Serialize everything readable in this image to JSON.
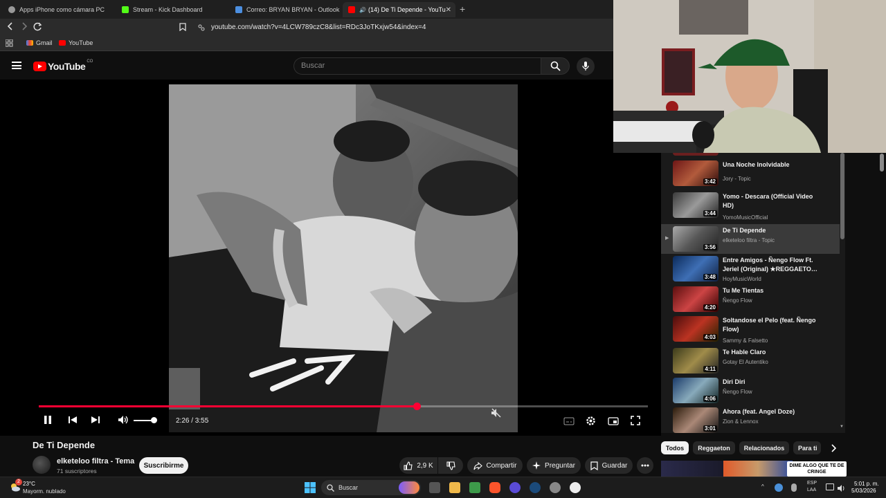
{
  "browser": {
    "tabs": [
      {
        "label": "Apps iPhone como cámara PC",
        "active": false
      },
      {
        "label": "Stream - Kick Dashboard",
        "active": false
      },
      {
        "label": "Correo: BRYAN BRYAN - Outlook",
        "active": false
      },
      {
        "label": "(14) De Ti Depende - YouTube",
        "active": true
      }
    ],
    "url": "youtube.com/watch?v=4LCW789czC8&list=RDc3JoTKxjw54&index=4",
    "bookmarks": [
      "Gmail",
      "YouTube"
    ]
  },
  "youtube": {
    "logo_text": "YouTube",
    "country_code": "CO",
    "search_placeholder": "Buscar"
  },
  "player": {
    "current_time": "2:26",
    "duration": "3:55",
    "time_display": "2:26 / 3:55",
    "progress_fraction": 0.621,
    "volume_fraction": 0.8
  },
  "video": {
    "title": "De Ti Depende",
    "channel": "elketeloo filtra - Tema",
    "subscribers": "71 suscriptores",
    "subscribe_label": "Suscribirme",
    "likes": "2,9 K",
    "share_label": "Compartir",
    "ask_label": "Preguntar",
    "save_label": "Guardar"
  },
  "playlist": [
    {
      "title": "Una Noche Inolvidable",
      "channel": "Jory - Topic",
      "duration": "3:42",
      "current": false
    },
    {
      "title": "Yomo - Descara (Official Video HD)",
      "channel": "YomoMusicOfficial",
      "duration": "3:44",
      "current": false
    },
    {
      "title": "De Ti Depende",
      "channel": "elketeloo filtra - Topic",
      "duration": "3:56",
      "current": true
    },
    {
      "title": "Entre Amigos - Ñengo Flow Ft. Jeriel (Original) ★REGGAETO…",
      "channel": "HoyMusicWorld",
      "duration": "3:48",
      "current": false
    },
    {
      "title": "Tu Me Tientas",
      "channel": "Ñengo Flow",
      "duration": "4:20",
      "current": false
    },
    {
      "title": "Soltandose el Pelo (feat. Ñengo Flow)",
      "channel": "Sammy & Falsetto",
      "duration": "4:03",
      "current": false
    },
    {
      "title": "Te Hable Claro",
      "channel": "Gotay El Autentiko",
      "duration": "4:11",
      "current": false
    },
    {
      "title": "Diri Diri",
      "channel": "Ñengo Flow",
      "duration": "4:06",
      "current": false
    },
    {
      "title": "Ahora (feat. Angel Doze)",
      "channel": "Zion & Lennox",
      "duration": "3:01",
      "current": false
    }
  ],
  "chips": [
    "Todos",
    "Reggaeton",
    "Relacionados",
    "Para ti"
  ],
  "recommendation_banner": "DIME ALGO QUE TE DE CRINGE",
  "taskbar": {
    "weather_temp": "23°C",
    "weather_desc": "Mayorm. nublado",
    "notification_count": "2",
    "search_label": "Buscar",
    "lang_line1": "ESP",
    "lang_line2": "LAA",
    "time": "5:01 p. m.",
    "date": "5/03/2026"
  },
  "colors": {
    "accent_red": "#ff0033",
    "background": "#0f0f0f"
  }
}
